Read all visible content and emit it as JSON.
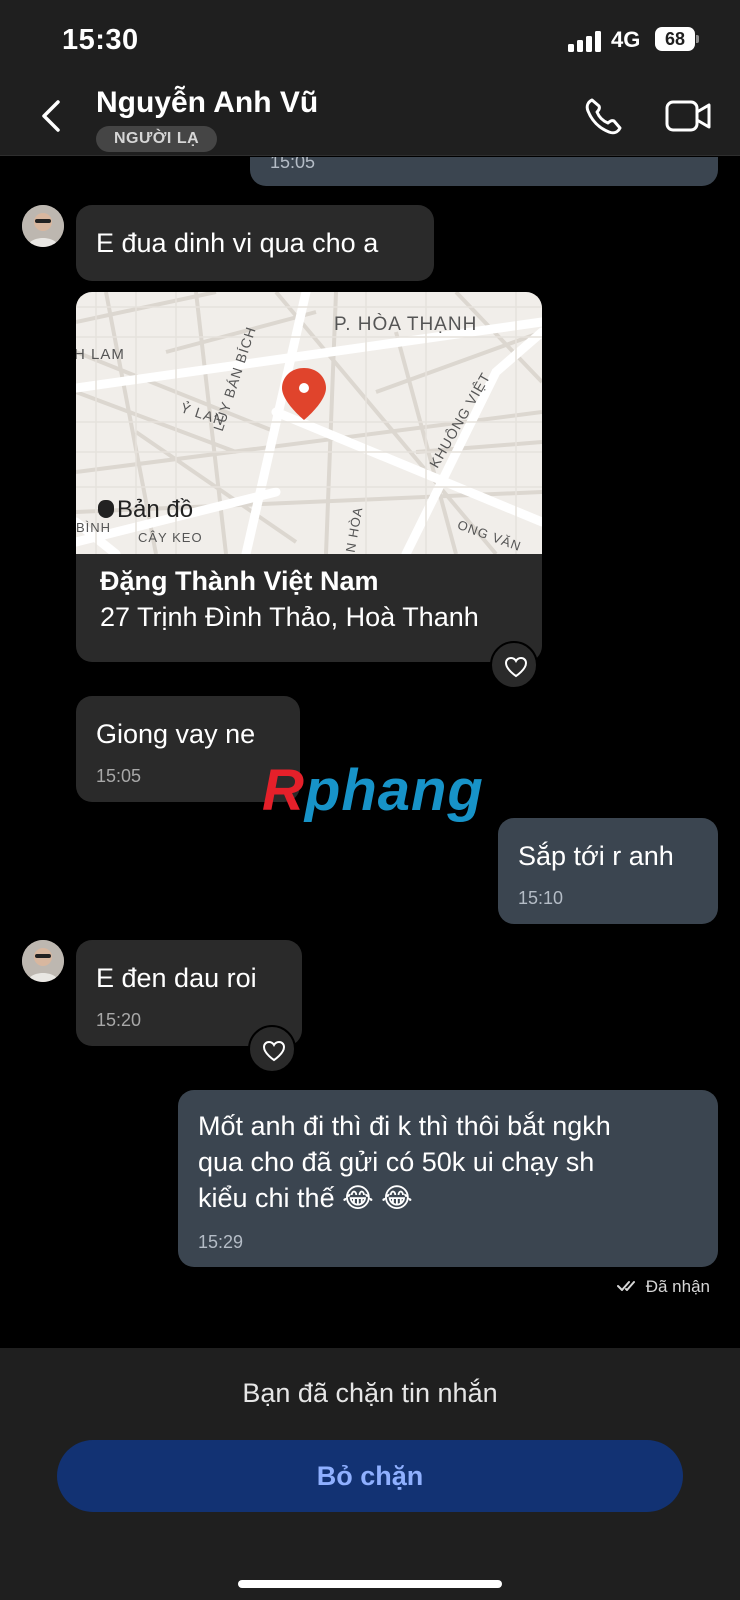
{
  "status_bar": {
    "time": "15:30",
    "network": "4G",
    "battery": "68"
  },
  "header": {
    "name": "Nguyễn Anh Vũ",
    "badge": "NGƯỜI LẠ"
  },
  "messages": {
    "prev_time": "15:05",
    "m1": {
      "text": "E đua dinh vi qua cho a"
    },
    "map": {
      "attribution": "Bản đồ",
      "labels": [
        "P. HÒA THẠNH",
        "H LAM",
        "Ỷ LAN",
        "LŨY BÁN BÍCH",
        "KHUÔNG VIỆT",
        "BÌNH",
        "CÂY KEO",
        "N HÒA",
        "ONG VĂN"
      ],
      "place_name": "Đặng Thành Việt Nam",
      "place_address": "27 Trịnh Đình Thảo, Hoà Thanh"
    },
    "m2": {
      "text": "Giong vay ne",
      "time": "15:05"
    },
    "m3": {
      "text": "Sắp tới r anh",
      "time": "15:10"
    },
    "m4": {
      "text": "E đen dau roi",
      "time": "15:20"
    },
    "m5": {
      "line1": "Mốt anh đi thì đi k thì thôi bắt ngkh",
      "line2": "qua cho đã gửi có 50k ui chạy sh",
      "line3": "kiểu chi thế 😂 😂",
      "time": "15:29"
    },
    "receipt": "Đã nhận"
  },
  "watermark": {
    "r": "R",
    "rest": "phang"
  },
  "footer": {
    "notice": "Bạn đã chặn tin nhắn",
    "unblock": "Bỏ chặn"
  }
}
